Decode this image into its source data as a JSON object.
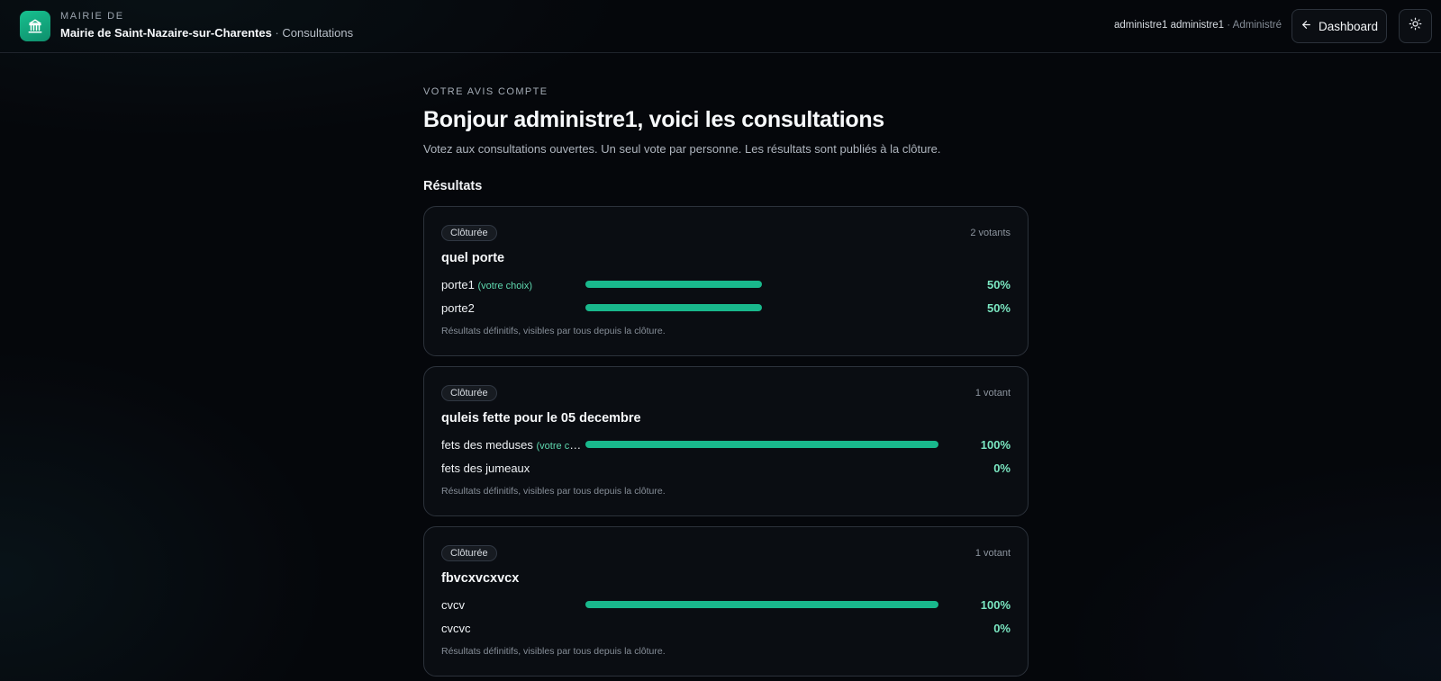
{
  "header": {
    "kicker": "MAIRIE DE",
    "municipality": "Mairie de Saint-Nazaire-sur-Charentes",
    "separator": " · ",
    "section": "Consultations",
    "user_name": "administre1 administre1",
    "user_role": "· Administré",
    "dashboard_label": "Dashboard",
    "logo_icon": "town-hall-icon",
    "theme_icon": "sun-icon"
  },
  "main": {
    "kicker": "VOTRE AVIS COMPTE",
    "title": "Bonjour administre1, voici les consultations",
    "subtitle": "Votez aux consultations ouvertes. Un seul vote par personne. Les résultats sont publiés à la clôture.",
    "section_title": "Résultats"
  },
  "colors": {
    "accent": "#19b88c",
    "percent": "#7ae6c1"
  },
  "consultations": [
    {
      "status": "Clôturée",
      "voters": "2 votants",
      "title": "quel porte",
      "options": [
        {
          "label": "porte1",
          "choice": "(votre choix)",
          "percent_label": "50%",
          "percent": 50
        },
        {
          "label": "porte2",
          "choice": "",
          "percent_label": "50%",
          "percent": 50
        }
      ],
      "note": "Résultats définitifs, visibles par tous depuis la clôture."
    },
    {
      "status": "Clôturée",
      "voters": "1 votant",
      "title": "quleis fette pour le 05 decembre",
      "options": [
        {
          "label": "fets des meduses",
          "choice": "(votre choix)",
          "percent_label": "100%",
          "percent": 100
        },
        {
          "label": "fets des jumeaux",
          "choice": "",
          "percent_label": "0%",
          "percent": 0
        }
      ],
      "note": "Résultats définitifs, visibles par tous depuis la clôture."
    },
    {
      "status": "Clôturée",
      "voters": "1 votant",
      "title": "fbvcxvcxvcx",
      "options": [
        {
          "label": "cvcv",
          "choice": "",
          "percent_label": "100%",
          "percent": 100
        },
        {
          "label": "cvcvc",
          "choice": "",
          "percent_label": "0%",
          "percent": 0
        }
      ],
      "note": "Résultats définitifs, visibles par tous depuis la clôture."
    }
  ]
}
